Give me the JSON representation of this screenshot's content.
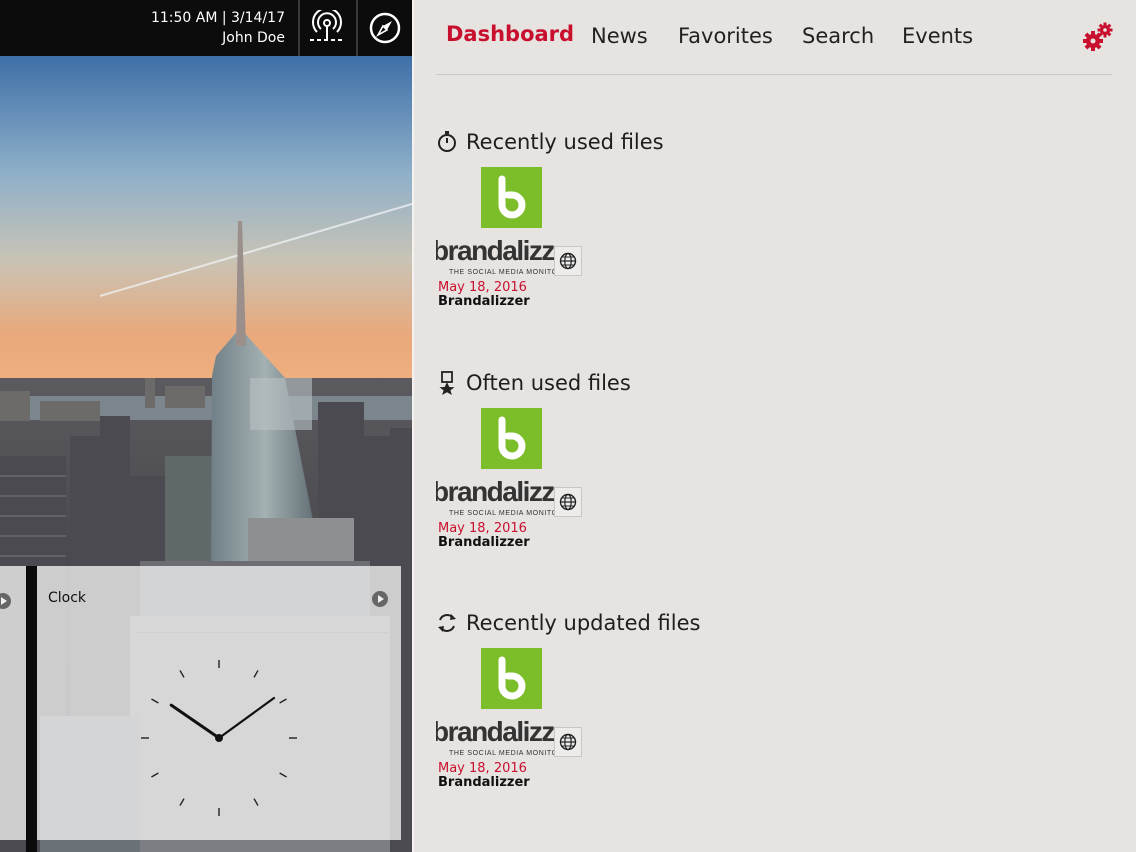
{
  "status": {
    "time": "11:50 AM | 3/14/17",
    "user": "John Doe"
  },
  "topbar_icons": [
    "broadcast-icon",
    "compass-icon"
  ],
  "widget": {
    "title": "Clock",
    "clock_time": {
      "hour": 10,
      "minute": 9
    }
  },
  "nav": {
    "tabs": [
      "Dashboard",
      "News",
      "Favorites",
      "Search",
      "Events"
    ],
    "active": "Dashboard",
    "settings_icon": "gears-icon"
  },
  "colors": {
    "accent": "#c8102e",
    "brand_green": "#7cbd2a",
    "panel_bg": "#e6e3e1",
    "topbar": "#0c0c0c"
  },
  "sections": [
    {
      "title": "Recently used files",
      "icon": "stopwatch-icon",
      "file": {
        "logo_text": "brandalizzer",
        "tagline": "THE SOCIAL MEDIA MONITOR",
        "date": "May 18, 2016",
        "name": "Brandalizzer"
      }
    },
    {
      "title": "Often used files",
      "icon": "pin-star-icon",
      "file": {
        "logo_text": "brandalizzer",
        "tagline": "THE SOCIAL MEDIA MONITOR",
        "date": "May 18, 2016",
        "name": "Brandalizzer"
      }
    },
    {
      "title": "Recently updated files",
      "icon": "refresh-icon",
      "file": {
        "logo_text": "brandalizzer",
        "tagline": "THE SOCIAL MEDIA MONITOR",
        "date": "May 18, 2016",
        "name": "Brandalizzer"
      }
    }
  ]
}
